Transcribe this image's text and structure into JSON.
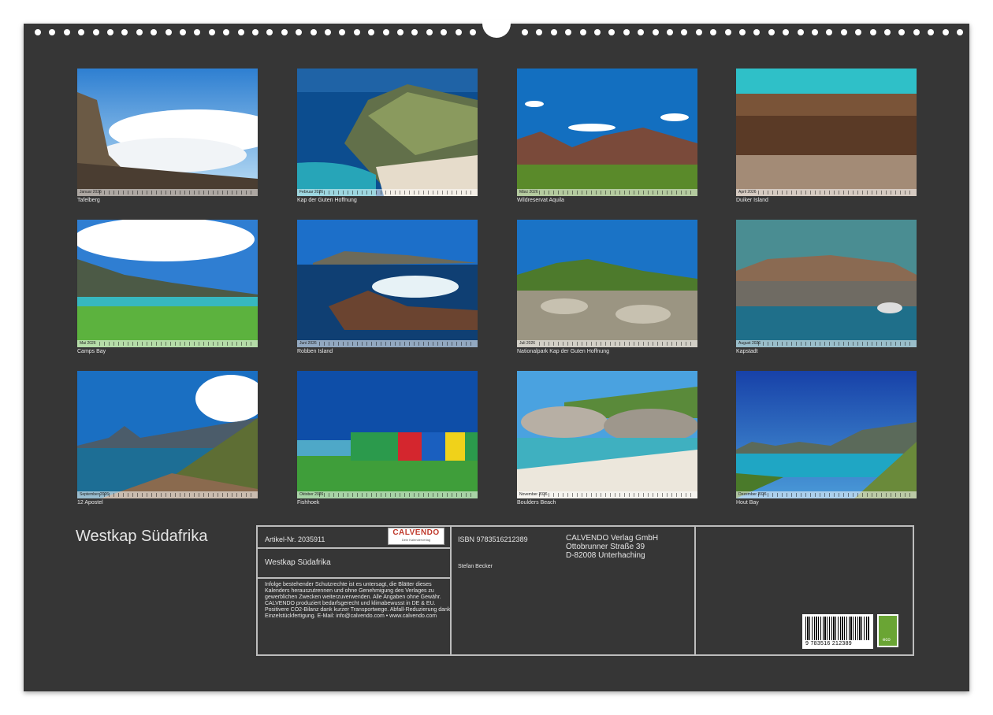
{
  "calendar_title": "Westkap Südafrika",
  "months": [
    {
      "caption": "Tafelberg",
      "strip_label": "Januar 2026"
    },
    {
      "caption": "Kap der Guten Hoffnung",
      "strip_label": "Februar 2026"
    },
    {
      "caption": "Wildreservat Aquila",
      "strip_label": "März 2026"
    },
    {
      "caption": "Duiker Island",
      "strip_label": "April 2026"
    },
    {
      "caption": "Camps Bay",
      "strip_label": "Mai 2026"
    },
    {
      "caption": "Robben Island",
      "strip_label": "Juni 2026"
    },
    {
      "caption": "Nationalpark Kap der Guten Hoffnung",
      "strip_label": "Juli 2026"
    },
    {
      "caption": "Kapstadt",
      "strip_label": "August 2026"
    },
    {
      "caption": "12 Apostel",
      "strip_label": "September 2026"
    },
    {
      "caption": "Fishhoek",
      "strip_label": "Oktober 2026"
    },
    {
      "caption": "Boulders Beach",
      "strip_label": "November 2026"
    },
    {
      "caption": "Hout Bay",
      "strip_label": "Dezember 2026"
    }
  ],
  "info": {
    "article_no": "Artikel-Nr. 2035911",
    "title": "Westkap Südafrika",
    "isbn": "ISBN 9783516212389",
    "author": "Stefan Becker",
    "publisher": [
      "CALVENDO Verlag GmbH",
      "Ottobrunner Straße 39",
      "D-82008 Unterhaching"
    ],
    "legal_text": "Infolge bestehender Schutzrechte ist es untersagt, die Blätter dieses Kalenders herauszutrennen und ohne Genehmigung des Verlages zu gewerblichen Zwecken weiterzuverwenden. Alle Angaben ohne Gewähr. CALVENDO produziert bedarfsgerecht und klimabewusst in DE & EU. Positivere CO2-Bilanz dank kurzer Transportwege. Abfall-Reduzierung dank Einzelstückfertigung. E-Mail: info@calvendo.com • www.calvendo.com",
    "logo": {
      "name": "CALVENDO",
      "tagline": "Dein Kalenderverlag"
    },
    "barcode_number": "9 783516 212389",
    "eco_label": "eco"
  },
  "colors": {
    "background": "#363636",
    "text": "#e6e6e6",
    "box_border": "#bdbdbd",
    "logo_red": "#c0392b",
    "eco_green": "#6aa534"
  }
}
